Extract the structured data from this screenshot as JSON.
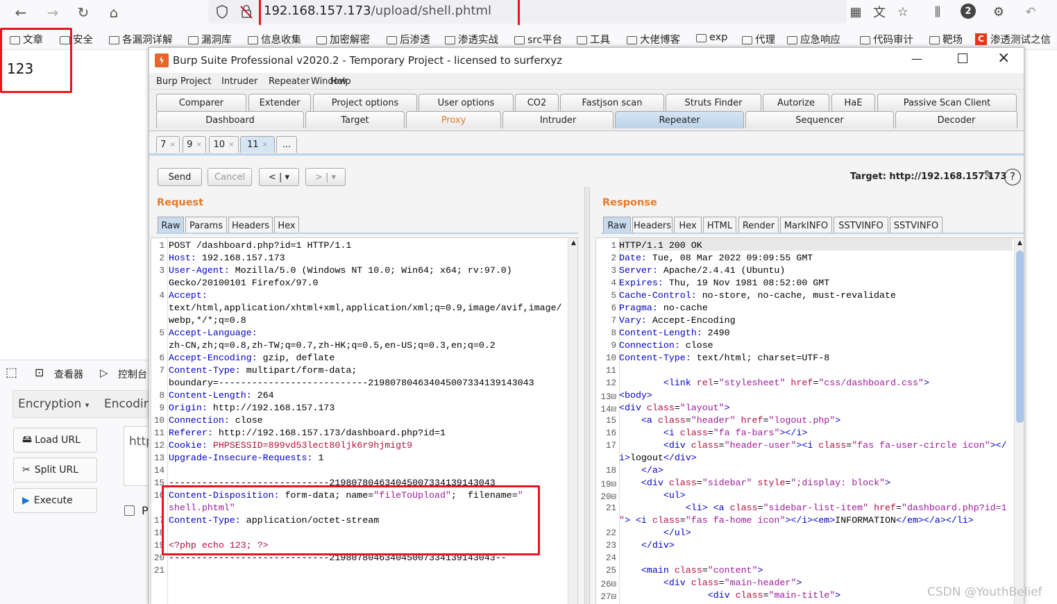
{
  "browser": {
    "url_host": "192.168.157.173",
    "url_path": "/upload/shell.phtml",
    "notif_count": "2",
    "bookmarks": [
      "文章",
      "安全",
      "各漏洞详解",
      "漏洞库",
      "信息收集",
      "加密解密",
      "后渗透",
      "渗透实战",
      "src平台",
      "工具",
      "大佬博客",
      "exp",
      "代理",
      "应急响应",
      "代码审计",
      "靶场",
      "渗透测试之信"
    ],
    "page_output": "123"
  },
  "devtools": {
    "inspector": "查看器",
    "console": "控制台",
    "encryption": "Encryption",
    "encoding": "Encodin",
    "load_url": "Load URL",
    "split_url": "Split URL",
    "execute": "Execute",
    "url_field": "http",
    "checkbox_label": "P"
  },
  "burp": {
    "title": "Burp Suite Professional v2020.2 - Temporary Project - licensed to surferxyz",
    "menu": [
      "Burp",
      "Project",
      "Intruder",
      "Repeater",
      "Window",
      "Help"
    ],
    "tabs_row1": [
      "Comparer",
      "Extender",
      "Project options",
      "User options",
      "CO2",
      "Fastjson scan",
      "Struts Finder",
      "Autorize",
      "HaE",
      "Passive Scan Client"
    ],
    "tabs_row2": [
      "Dashboard",
      "Target",
      "Proxy",
      "Intruder",
      "Repeater",
      "Sequencer",
      "Decoder"
    ],
    "repeater_tabs": [
      "7",
      "9",
      "10",
      "11",
      "..."
    ],
    "send": "Send",
    "cancel": "Cancel",
    "target_label": "Target: http://192.168.157.173",
    "request_title": "Request",
    "response_title": "Response",
    "request_tabs": [
      "Raw",
      "Params",
      "Headers",
      "Hex"
    ],
    "response_tabs": [
      "Raw",
      "Headers",
      "Hex",
      "HTML",
      "Render",
      "MarkINFO",
      "SSTVINFO",
      "SSTVINFO"
    ]
  },
  "watermark": "CSDN @YouthBelief",
  "colors": {
    "highlight": "#e8141f",
    "burp_orange": "#e57b2b",
    "keyword": "#0000c8",
    "string": "#9b1b9b"
  }
}
